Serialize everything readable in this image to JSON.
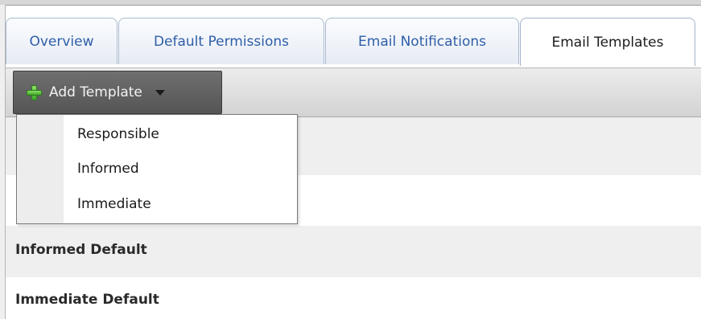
{
  "tabs": [
    {
      "label": "Overview"
    },
    {
      "label": "Default Permissions"
    },
    {
      "label": "Email Notifications"
    },
    {
      "label": "Email Templates"
    }
  ],
  "toolbar": {
    "add_template_label": "Add Template",
    "add_icon": "plus-icon",
    "dropdown_icon": "caret-down-icon"
  },
  "menu": {
    "items": [
      {
        "label": "Responsible"
      },
      {
        "label": "Informed"
      },
      {
        "label": "Immediate"
      }
    ]
  },
  "rows": [
    {
      "label": ""
    },
    {
      "label": ""
    },
    {
      "label": "Informed Default"
    },
    {
      "label": "Immediate Default"
    }
  ],
  "colors": {
    "tab_text": "#2f5ea8",
    "toolbar_button": "#5f5f5f",
    "row_alt": "#efefef"
  }
}
